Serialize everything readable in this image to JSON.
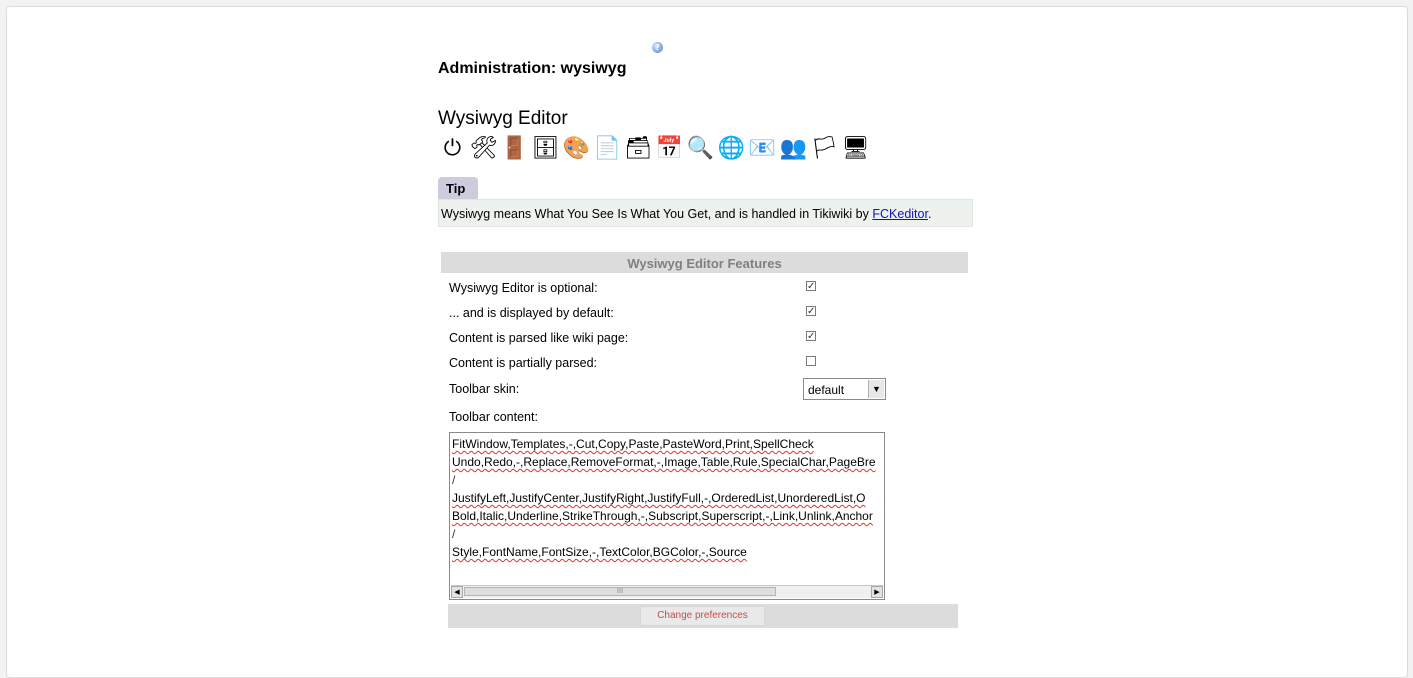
{
  "header": {
    "help_icon": "help-icon",
    "title": "Administration: wysiwyg"
  },
  "section": {
    "title": "Wysiwyg Editor"
  },
  "admin_icons": [
    {
      "name": "power-icon",
      "glyph": "⏻"
    },
    {
      "name": "tools-icon",
      "glyph": "🛠"
    },
    {
      "name": "login-door-icon",
      "glyph": "🚪"
    },
    {
      "name": "features-icon",
      "glyph": "🗄"
    },
    {
      "name": "look-palette-icon",
      "glyph": "🎨"
    },
    {
      "name": "text-area-icon",
      "glyph": "📄"
    },
    {
      "name": "modules-icon",
      "glyph": "🗃"
    },
    {
      "name": "calendar-icon",
      "glyph": "📅"
    },
    {
      "name": "search-magnifier-icon",
      "glyph": "🔍"
    },
    {
      "name": "community-globe-icon",
      "glyph": "🌐"
    },
    {
      "name": "webmail-icon",
      "glyph": "📧"
    },
    {
      "name": "users-icon",
      "glyph": "👥"
    },
    {
      "name": "i18n-flag-icon",
      "glyph": "🏳"
    },
    {
      "name": "wysiwyg-icon",
      "glyph": "🖥"
    }
  ],
  "tip": {
    "tab_label": "Tip",
    "text": "Wysiwyg means What You See Is What You Get, and is handled in Tikiwiki by ",
    "link_text": "FCKeditor",
    "suffix": "."
  },
  "features": {
    "heading": "Wysiwyg Editor Features",
    "options": [
      {
        "label": "Wysiwyg Editor is optional:",
        "checked": true
      },
      {
        "label": "... and is displayed by default:",
        "checked": true
      },
      {
        "label": "Content is parsed like wiki page:",
        "checked": true
      },
      {
        "label": "Content is partially parsed:",
        "checked": false
      }
    ],
    "toolbar_skin_label": "Toolbar skin:",
    "toolbar_skin_value": "default",
    "toolbar_content_label": "Toolbar content:",
    "toolbar_content_lines": [
      "FitWindow,Templates,-,Cut,Copy,Paste,PasteWord,Print,SpellCheck",
      "Undo,Redo,-,Replace,RemoveFormat,-,Image,Table,Rule,SpecialChar,PageBre",
      "/",
      "JustifyLeft,JustifyCenter,JustifyRight,JustifyFull,-,OrderedList,UnorderedList,O",
      "Bold,Italic,Underline,StrikeThrough,-,Subscript,Superscript,-,Link,Unlink,Anchor",
      "/",
      "Style,FontName,FontSize,-,TextColor,BGColor,-,Source"
    ],
    "scroll_grip": "III",
    "submit_label": "Change preferences"
  }
}
